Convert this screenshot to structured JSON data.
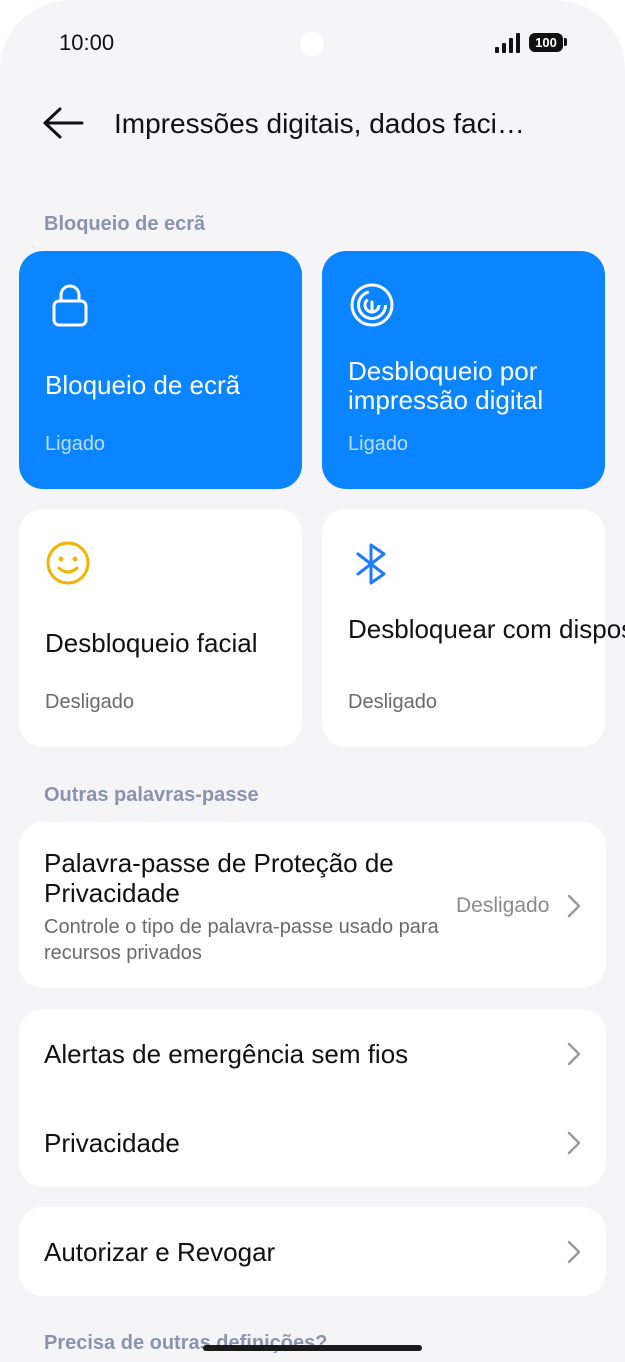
{
  "status_bar": {
    "time": "10:00",
    "battery": "100"
  },
  "header": {
    "title": "Impressões digitais, dados faci…"
  },
  "sections": {
    "screen_lock": "Bloqueio de ecrã",
    "other_passwords": "Outras palavras-passe",
    "more_settings": "Precisa de outras definições?"
  },
  "tiles": [
    {
      "title": "Bloqueio de ecrã",
      "status": "Ligado",
      "icon": "lock-icon",
      "active": true
    },
    {
      "title": "Desbloqueio por impressão digital",
      "status": "Ligado",
      "icon": "fingerprint-icon",
      "active": true
    },
    {
      "title": "Desbloqueio facial",
      "status": "Desligado",
      "icon": "smiley-face-icon",
      "active": false
    },
    {
      "title": "Desbloquear com dispositivo …",
      "status": "Desligado",
      "icon": "bluetooth-icon",
      "active": false
    }
  ],
  "privacy_password": {
    "title": "Palavra-passe de Proteção de Privacidade",
    "subtitle": "Controle o tipo de palavra-passe usado para recursos privados",
    "value": "Desligado"
  },
  "list_items": [
    {
      "label": "Alertas de emergência sem fios"
    },
    {
      "label": "Privacidade"
    },
    {
      "label": "Autorizar e Revogar"
    }
  ],
  "colors": {
    "accent": "#0a84ff",
    "background": "#f5f5f7",
    "section_header": "#8a93b0",
    "face_icon": "#f5b301",
    "bluetooth_icon": "#1e7bff"
  }
}
